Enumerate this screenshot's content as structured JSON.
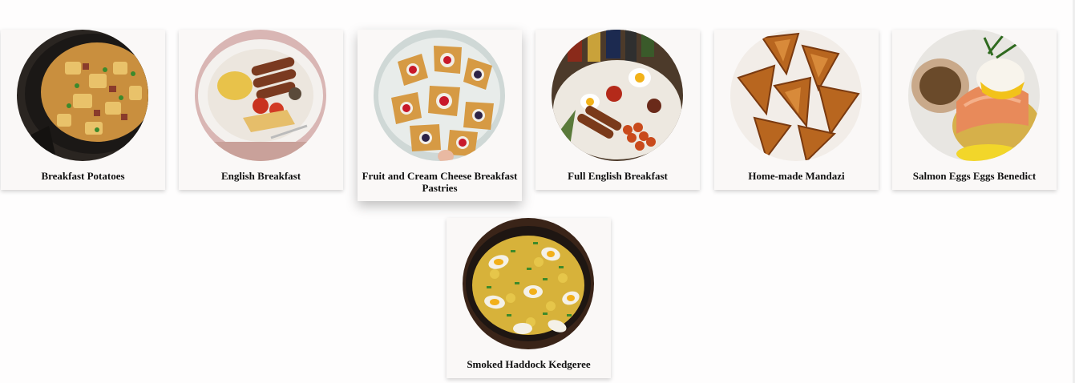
{
  "recipes": [
    {
      "title": "Breakfast Potatoes"
    },
    {
      "title": "English Breakfast"
    },
    {
      "title": "Fruit and Cream Cheese Breakfast Pastries"
    },
    {
      "title": "Full English Breakfast"
    },
    {
      "title": "Home-made Mandazi"
    },
    {
      "title": "Salmon Eggs Eggs Benedict"
    },
    {
      "title": "Smoked Haddock Kedgeree"
    }
  ]
}
